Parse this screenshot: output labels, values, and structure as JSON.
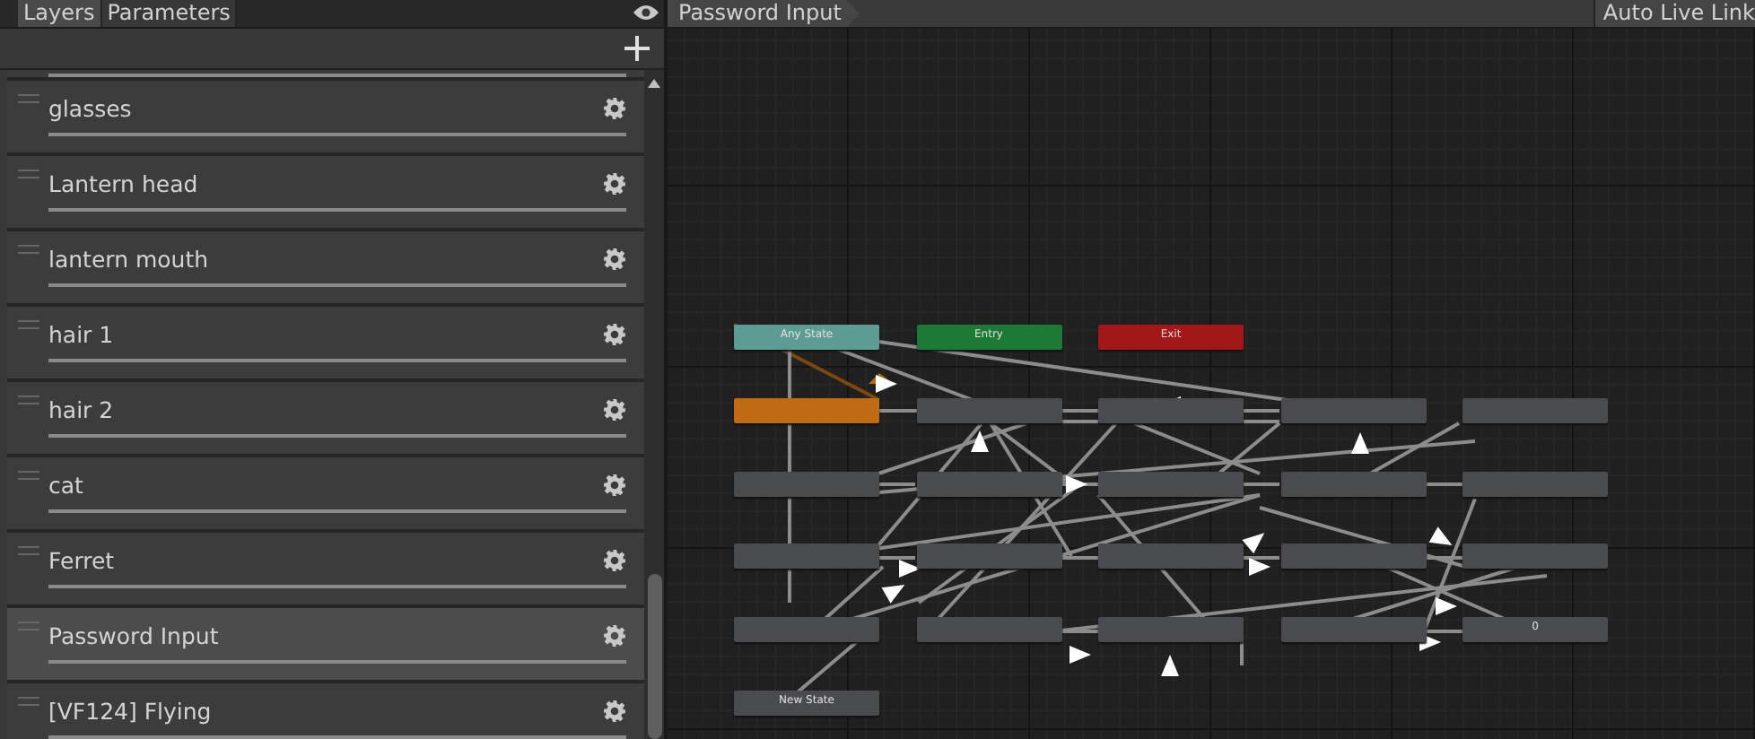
{
  "left_tabs": [
    {
      "label": "Layers",
      "selected": true
    },
    {
      "label": "Parameters",
      "selected": false
    }
  ],
  "layers": [
    {
      "selected": false
    },
    {
      "label": "glasses",
      "selected": false
    },
    {
      "label": "Lantern head",
      "selected": false
    },
    {
      "label": "lantern mouth",
      "selected": false
    },
    {
      "label": "hair 1",
      "selected": false
    },
    {
      "label": "hair 2",
      "selected": false
    },
    {
      "label": "cat",
      "selected": false
    },
    {
      "label": "Ferret",
      "selected": false
    },
    {
      "label": "Password Input",
      "selected": true
    },
    {
      "label": "[VF124] Flying",
      "selected": false
    }
  ],
  "graph": {
    "breadcrumb": "Password Input",
    "auto_live_link": "Auto Live Link",
    "special_nodes": [
      {
        "kind": "any",
        "label": "Any State"
      },
      {
        "kind": "entry",
        "label": "Entry"
      },
      {
        "kind": "exit",
        "label": "Exit"
      }
    ],
    "state_rows": [
      [
        {
          "kind": "default"
        },
        {
          "kind": "state"
        },
        {
          "kind": "state"
        },
        {
          "kind": "state"
        },
        {
          "kind": "state"
        }
      ],
      [
        {
          "kind": "state"
        },
        {
          "kind": "state"
        },
        {
          "kind": "state"
        },
        {
          "kind": "state"
        },
        {
          "kind": "state"
        }
      ],
      [
        {
          "kind": "state"
        },
        {
          "kind": "state"
        },
        {
          "kind": "state"
        },
        {
          "kind": "state"
        },
        {
          "kind": "state"
        }
      ],
      [
        {
          "kind": "state"
        },
        {
          "kind": "state"
        },
        {
          "kind": "state"
        },
        {
          "kind": "state"
        },
        {
          "kind": "state",
          "label": "0"
        }
      ],
      [
        {
          "kind": "state",
          "label": "New State"
        }
      ]
    ]
  }
}
